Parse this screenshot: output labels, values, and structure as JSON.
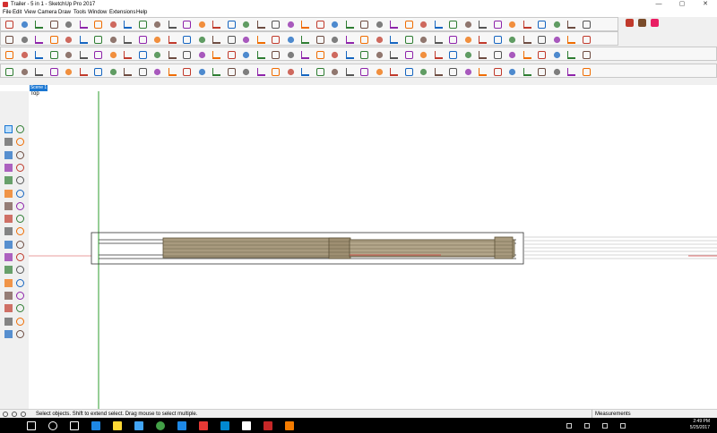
{
  "window": {
    "title": "Trailer - 5 in 1 - SketchUp Pro 2017",
    "minimize": "—",
    "maximize": "▢",
    "close": "✕"
  },
  "menu": [
    "File",
    "Edit",
    "View",
    "Camera",
    "Draw",
    "Tools",
    "Window",
    "Extensions",
    "Help"
  ],
  "scene_tab": "Scene 1",
  "view_label": "Top",
  "status": {
    "message": "Select objects. Shift to extend select. Drag mouse to select multiple.",
    "measurements_label": "Measurements"
  },
  "clock": {
    "time": "2:49 PM",
    "date": "5/25/2017"
  },
  "colors": {
    "accent": "#1976d2",
    "model_fill": "#a89a7e",
    "model_stroke": "#5c5238",
    "green_axis": "#2e9e2e",
    "red_axis": "#d33b3b",
    "taskbar": "#000000"
  },
  "icons": {
    "toolbar_row1": [
      "undo-icon",
      "redo-icon",
      "cut-icon",
      "copy-icon",
      "paste-icon",
      "erase-icon",
      "print-icon",
      "model-info-icon",
      "select-icon",
      "make-component-icon",
      "paint-bucket-icon",
      "eraser-icon",
      "rectangle-icon",
      "line-icon",
      "circle-icon",
      "arc-icon",
      "polygon-icon",
      "freehand-icon",
      "move-icon",
      "push-pull-icon",
      "rotate-icon",
      "follow-me-icon",
      "scale-icon",
      "offset-icon",
      "tape-measure-icon",
      "dimension-icon",
      "protractor-icon",
      "text-icon",
      "axes-icon",
      "3d-text-icon",
      "orbit-icon",
      "pan-icon",
      "zoom-icon",
      "zoom-window-icon",
      "zoom-extents-icon",
      "previous-view-icon",
      "next-view-icon"
    ],
    "left_toolbar": [
      "select-icon",
      "component-icon",
      "paint-icon",
      "eraser-icon",
      "line-icon",
      "freehand-icon",
      "rectangle-icon",
      "rotated-rect-icon",
      "circle-icon",
      "polygon-icon",
      "arc-icon",
      "pie-icon",
      "move-icon",
      "push-pull-icon",
      "rotate-icon",
      "follow-me-icon",
      "scale-icon",
      "offset-icon",
      "tape-icon",
      "dimension-icon",
      "protractor-icon",
      "text-icon",
      "axes-icon",
      "3d-text-icon",
      "orbit-icon",
      "pan-icon",
      "zoom-icon",
      "zoom-window-icon",
      "zoom-extents-icon",
      "walk-icon",
      "look-around-icon",
      "position-camera-icon",
      "section-plane-icon",
      "display-section-icon"
    ],
    "taskbar": [
      "windows-start-icon",
      "search-icon",
      "task-view-icon",
      "edge-icon",
      "explorer-icon",
      "store-icon",
      "chrome-icon",
      "photos-icon",
      "sketchup-icon",
      "mail-icon",
      "app-icon",
      "autodesk-icon",
      "vlc-icon"
    ]
  }
}
